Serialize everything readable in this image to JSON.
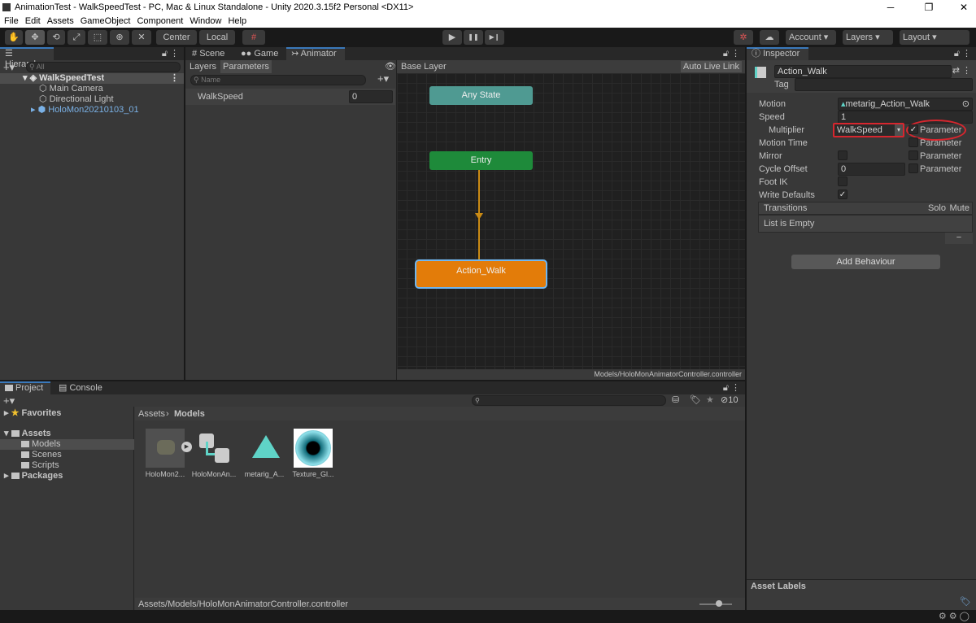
{
  "window": {
    "title": "AnimationTest - WalkSpeedTest - PC, Mac & Linux Standalone - Unity 2020.3.15f2 Personal <DX11>",
    "minimize": "─",
    "maximize": "❐",
    "close": "✕"
  },
  "menu": [
    "File",
    "Edit",
    "Assets",
    "GameObject",
    "Component",
    "Window",
    "Help"
  ],
  "toolbar": {
    "tools": [
      "✋",
      "✥",
      "⟲",
      "⤢",
      "⬚",
      "⊕",
      "✕"
    ],
    "center": "Center",
    "local": "Local",
    "account": "Account",
    "layers": "Layers",
    "layout": "Layout",
    "play": "▶",
    "pause": "❚❚",
    "step": "▶❙"
  },
  "hierarchy": {
    "tab": "Hierarchy",
    "search_placeholder": "All",
    "scene": "WalkSpeedTest",
    "items": [
      "Main Camera",
      "Directional Light",
      "HoloMon20210103_01"
    ]
  },
  "animator": {
    "tabs": [
      "Scene",
      "Game",
      "Animator"
    ],
    "sub_tabs": [
      "Layers",
      "Parameters"
    ],
    "search_placeholder": "Name",
    "parameters": [
      {
        "name": "WalkSpeed",
        "value": "0"
      }
    ],
    "breadcrumb": "Base Layer",
    "auto_live_link": "Auto Live Link",
    "states": {
      "any": "Any State",
      "entry": "Entry",
      "action": "Action_Walk"
    },
    "colors": {
      "any": "#4f9a92",
      "entry": "#1e8a3a",
      "action": "#e37c09",
      "transition": "#c98a14"
    },
    "footer": "Models/HoloMonAnimatorController.controller"
  },
  "inspector": {
    "tab": "Inspector",
    "name": "Action_Walk",
    "tag_label": "Tag",
    "rows": {
      "motion": "Motion",
      "motion_value": "metarig_Action_Walk",
      "speed": "Speed",
      "speed_value": "1",
      "multiplier": "Multiplier",
      "multiplier_value": "WalkSpeed",
      "motion_time": "Motion Time",
      "mirror": "Mirror",
      "cycle_offset": "Cycle Offset",
      "cycle_offset_value": "0",
      "foot_ik": "Foot IK",
      "write_defaults": "Write Defaults",
      "parameter": "Parameter"
    },
    "checks": {
      "multiplier_parameter": true,
      "motion_time_parameter": false,
      "mirror": false,
      "mirror_parameter": false,
      "cycle_offset_parameter": false,
      "foot_ik": false,
      "write_defaults": true
    },
    "transitions": "Transitions",
    "solo": "Solo",
    "mute": "Mute",
    "list_empty": "List is Empty",
    "minus": "−",
    "add_behaviour": "Add Behaviour",
    "asset_labels": "Asset Labels",
    "highlight_color": "#d7262e"
  },
  "project": {
    "tabs": [
      "Project",
      "Console"
    ],
    "favorites": "Favorites",
    "assets": "Assets",
    "folders": [
      "Models",
      "Scenes",
      "Scripts"
    ],
    "packages": "Packages",
    "breadcrumb": [
      "Assets",
      "Models"
    ],
    "hidden_count": "10",
    "items": [
      "HoloMon2...",
      "HoloMonAn...",
      "metarig_A...",
      "Texture_Gl..."
    ],
    "footer": "Assets/Models/HoloMonAnimatorController.controller"
  }
}
